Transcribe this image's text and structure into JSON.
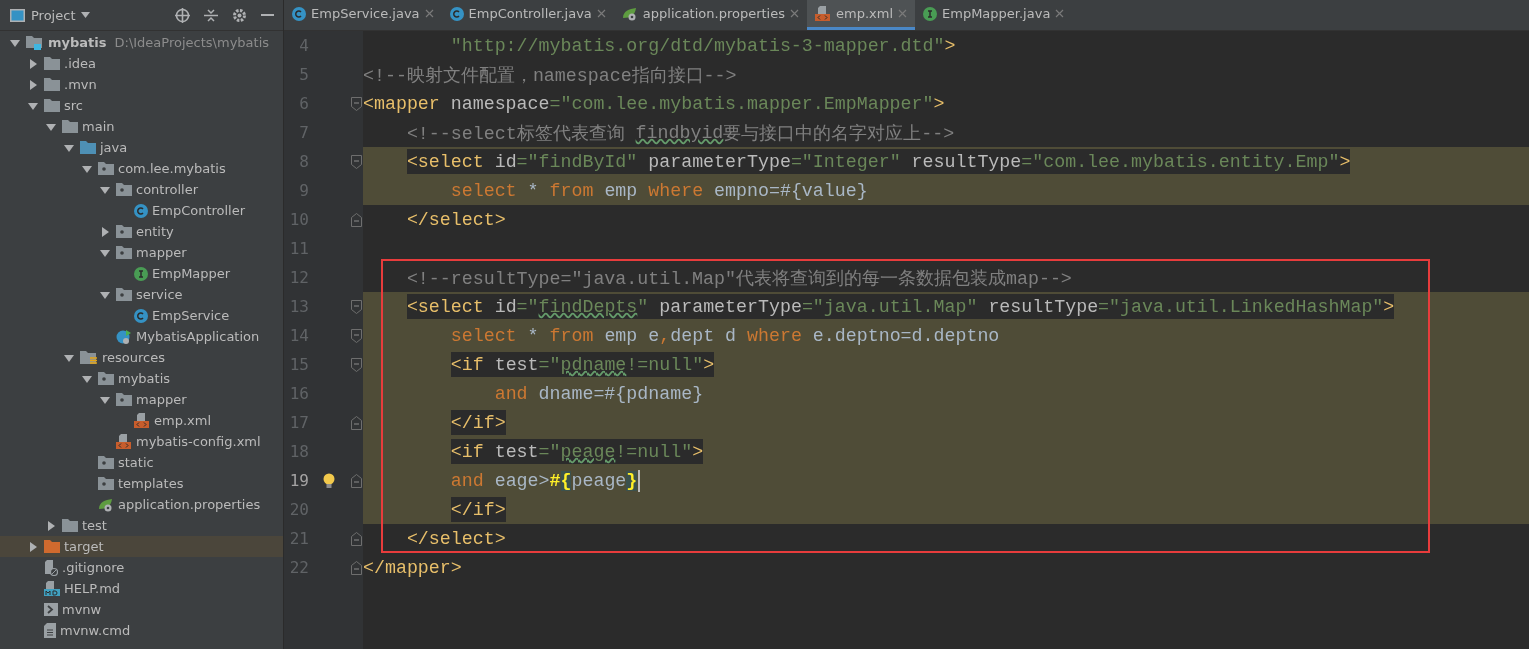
{
  "project_panel": {
    "title": "Project",
    "tree": [
      {
        "label": "mybatis",
        "path": "D:\\IdeaProjects\\mybatis",
        "kind": "module",
        "expanded": true,
        "selected": false,
        "children": [
          {
            "label": ".idea",
            "kind": "folder",
            "expanded": false,
            "selected": false
          },
          {
            "label": ".mvn",
            "kind": "folder",
            "expanded": false,
            "selected": false
          },
          {
            "label": "src",
            "kind": "folder",
            "expanded": true,
            "selected": false,
            "children": [
              {
                "label": "main",
                "kind": "folder",
                "expanded": true,
                "selected": false,
                "children": [
                  {
                    "label": "java",
                    "kind": "source",
                    "expanded": true,
                    "selected": false,
                    "children": [
                      {
                        "label": "com.lee.mybatis",
                        "kind": "package",
                        "expanded": true,
                        "selected": false,
                        "children": [
                          {
                            "label": "controller",
                            "kind": "package",
                            "expanded": true,
                            "selected": false,
                            "children": [
                              {
                                "label": "EmpController",
                                "kind": "class",
                                "selected": false
                              }
                            ]
                          },
                          {
                            "label": "entity",
                            "kind": "package",
                            "expanded": false,
                            "selected": false
                          },
                          {
                            "label": "mapper",
                            "kind": "package",
                            "expanded": true,
                            "selected": false,
                            "children": [
                              {
                                "label": "EmpMapper",
                                "kind": "interface",
                                "selected": false
                              }
                            ]
                          },
                          {
                            "label": "service",
                            "kind": "package",
                            "expanded": true,
                            "selected": false,
                            "children": [
                              {
                                "label": "EmpService",
                                "kind": "class",
                                "selected": false
                              }
                            ]
                          },
                          {
                            "label": "MybatisApplication",
                            "kind": "app",
                            "selected": false
                          }
                        ]
                      }
                    ]
                  },
                  {
                    "label": "resources",
                    "kind": "resources",
                    "expanded": true,
                    "selected": false,
                    "children": [
                      {
                        "label": "mybatis",
                        "kind": "package",
                        "expanded": true,
                        "selected": false,
                        "children": [
                          {
                            "label": "mapper",
                            "kind": "package",
                            "expanded": true,
                            "selected": false,
                            "children": [
                              {
                                "label": "emp.xml",
                                "kind": "xml",
                                "selected": false
                              }
                            ]
                          },
                          {
                            "label": "mybatis-config.xml",
                            "kind": "xml",
                            "selected": false
                          }
                        ]
                      },
                      {
                        "label": "static",
                        "kind": "package",
                        "selected": false
                      },
                      {
                        "label": "templates",
                        "kind": "package",
                        "selected": false
                      },
                      {
                        "label": "application.properties",
                        "kind": "properties",
                        "selected": false
                      }
                    ]
                  }
                ]
              },
              {
                "label": "test",
                "kind": "folder",
                "expanded": false,
                "selected": false
              }
            ]
          },
          {
            "label": "target",
            "kind": "excluded",
            "expanded": false,
            "selected": true
          },
          {
            "label": ".gitignore",
            "kind": "ignore",
            "selected": false
          },
          {
            "label": "HELP.md",
            "kind": "md",
            "selected": false
          },
          {
            "label": "mvnw",
            "kind": "script",
            "selected": false
          },
          {
            "label": "mvnw.cmd",
            "kind": "text",
            "selected": false
          }
        ]
      }
    ]
  },
  "tabs": [
    {
      "label": "EmpService.java",
      "kind": "class",
      "selected": false
    },
    {
      "label": "EmpController.java",
      "kind": "class",
      "selected": false
    },
    {
      "label": "application.properties",
      "kind": "properties",
      "selected": false
    },
    {
      "label": "emp.xml",
      "kind": "xml",
      "selected": true
    },
    {
      "label": "EmpMapper.java",
      "kind": "interface",
      "selected": false
    }
  ],
  "blocks": [
    {
      "boxed": false,
      "lines": [
        {
          "n": "4",
          "highlighted": false,
          "tag_backdrop": false,
          "fold_start": false,
          "fold_end": false,
          "current": false,
          "bulb": false,
          "tokens": [
            {
              "kind": "str",
              "text": "        \"http://mybatis.org/dtd/mybatis-3-mapper.dtd\""
            },
            {
              "kind": "tag",
              "text": ">"
            }
          ]
        },
        {
          "n": "5",
          "highlighted": false,
          "tag_backdrop": false,
          "fold_start": false,
          "fold_end": false,
          "current": false,
          "bulb": false,
          "tokens": [
            {
              "kind": "comment",
              "text": "<!--映射文件配置，namespace指向接口-->"
            }
          ]
        },
        {
          "n": "6",
          "highlighted": false,
          "tag_backdrop": false,
          "fold_start": true,
          "fold_end": false,
          "current": false,
          "bulb": false,
          "tokens": [
            {
              "kind": "tag",
              "text": "<mapper"
            },
            {
              "kind": "attr",
              "text": " namespace"
            },
            {
              "kind": "str",
              "text": "=\"com.lee.mybatis.mapper.EmpMapper\""
            },
            {
              "kind": "tag",
              "text": ">"
            }
          ]
        },
        {
          "n": "7",
          "highlighted": false,
          "tag_backdrop": false,
          "fold_start": false,
          "fold_end": false,
          "current": false,
          "bulb": false,
          "tokens": [
            {
              "kind": "comment",
              "text": "    <!--select标签代表查询 "
            },
            {
              "kind": "commenttypo",
              "text": "findbyid"
            },
            {
              "kind": "comment",
              "text": "要与接口中的名字对应上-->"
            }
          ]
        },
        {
          "n": "8",
          "highlighted": true,
          "tag_backdrop": true,
          "fold_start": true,
          "fold_end": false,
          "current": false,
          "bulb": false,
          "tokens": [
            {
              "kind": "tag",
              "text": "    <select"
            },
            {
              "kind": "attr",
              "text": " id"
            },
            {
              "kind": "str",
              "text": "=\"findById\""
            },
            {
              "kind": "attr",
              "text": " parameterType"
            },
            {
              "kind": "str",
              "text": "=\"Integer\""
            },
            {
              "kind": "attr",
              "text": " resultType"
            },
            {
              "kind": "str",
              "text": "=\"com.lee.mybatis.entity.Emp\""
            },
            {
              "kind": "tag",
              "text": ">"
            }
          ]
        },
        {
          "n": "9",
          "highlighted": true,
          "tag_backdrop": false,
          "fold_start": false,
          "fold_end": false,
          "current": false,
          "bulb": false,
          "tokens": [
            {
              "kind": "kw",
              "text": "        select"
            },
            {
              "kind": "plain",
              "text": " * "
            },
            {
              "kind": "kw",
              "text": "from"
            },
            {
              "kind": "plain",
              "text": " emp "
            },
            {
              "kind": "kw",
              "text": "where"
            },
            {
              "kind": "plain",
              "text": " empno=#{value}"
            }
          ]
        },
        {
          "n": "10",
          "highlighted": false,
          "tag_backdrop": true,
          "fold_start": false,
          "fold_end": true,
          "current": false,
          "bulb": false,
          "tokens": [
            {
              "kind": "tag",
              "text": "    </select>"
            }
          ]
        },
        {
          "n": "11",
          "highlighted": false,
          "fold_start": false,
          "fold_end": false,
          "current": false,
          "bulb": false
        }
      ]
    },
    {
      "boxed": true,
      "lines": [
        {
          "n": "12",
          "highlighted": false,
          "tag_backdrop": false,
          "fold_start": false,
          "fold_end": false,
          "current": false,
          "bulb": false,
          "tokens": [
            {
              "kind": "comment",
              "text": "    <!--resultType=\"java.util.Map\"代表将查询到的每一条数据包装成map-->"
            }
          ]
        },
        {
          "n": "13",
          "highlighted": true,
          "tag_backdrop": true,
          "fold_start": true,
          "fold_end": false,
          "current": false,
          "bulb": false,
          "tokens": [
            {
              "kind": "tag",
              "text": "    <select"
            },
            {
              "kind": "attr",
              "text": " id"
            },
            {
              "kind": "str",
              "text": "=\""
            },
            {
              "kind": "strtypo",
              "text": "findDepts"
            },
            {
              "kind": "str",
              "text": "\""
            },
            {
              "kind": "attr",
              "text": " parameterType"
            },
            {
              "kind": "str",
              "text": "=\"java.util.Map\""
            },
            {
              "kind": "attr",
              "text": " resultType"
            },
            {
              "kind": "str",
              "text": "=\"java.util.LinkedHashMap\""
            },
            {
              "kind": "tag",
              "text": ">"
            }
          ]
        },
        {
          "n": "14",
          "highlighted": true,
          "tag_backdrop": false,
          "fold_start": true,
          "fold_end": false,
          "current": false,
          "bulb": false,
          "tokens": [
            {
              "kind": "kw",
              "text": "        select"
            },
            {
              "kind": "plain",
              "text": " * "
            },
            {
              "kind": "kw",
              "text": "from"
            },
            {
              "kind": "plain",
              "text": " emp e"
            },
            {
              "kind": "kw",
              "text": ","
            },
            {
              "kind": "plain",
              "text": "dept d "
            },
            {
              "kind": "kw",
              "text": "where"
            },
            {
              "kind": "plain",
              "text": " e.deptno=d.deptno"
            }
          ]
        },
        {
          "n": "15",
          "highlighted": true,
          "tag_backdrop": true,
          "fold_start": true,
          "fold_end": false,
          "current": false,
          "bulb": false,
          "tokens": [
            {
              "kind": "tag",
              "text": "        <if"
            },
            {
              "kind": "attr",
              "text": " test"
            },
            {
              "kind": "str",
              "text": "=\""
            },
            {
              "kind": "strtypo",
              "text": "pdname"
            },
            {
              "kind": "str",
              "text": "!=null\""
            },
            {
              "kind": "tag",
              "text": ">"
            }
          ]
        },
        {
          "n": "16",
          "highlighted": true,
          "tag_backdrop": false,
          "fold_start": false,
          "fold_end": false,
          "current": false,
          "bulb": false,
          "tokens": [
            {
              "kind": "kw",
              "text": "            and"
            },
            {
              "kind": "plain",
              "text": " dname=#{pdname}"
            }
          ]
        },
        {
          "n": "17",
          "highlighted": true,
          "tag_backdrop": true,
          "fold_start": false,
          "fold_end": true,
          "current": false,
          "bulb": false,
          "tokens": [
            {
              "kind": "tag",
              "text": "        </if>"
            }
          ]
        },
        {
          "n": "18",
          "highlighted": true,
          "tag_backdrop": true,
          "fold_start": false,
          "fold_end": false,
          "current": false,
          "bulb": false,
          "tokens": [
            {
              "kind": "tag",
              "text": "        <if"
            },
            {
              "kind": "attr",
              "text": " test"
            },
            {
              "kind": "str",
              "text": "=\""
            },
            {
              "kind": "strtypo",
              "text": "peage"
            },
            {
              "kind": "str",
              "text": "!=null\""
            },
            {
              "kind": "tag",
              "text": ">"
            }
          ]
        },
        {
          "n": "19",
          "highlighted": true,
          "tag_backdrop": false,
          "fold_start": false,
          "fold_end": true,
          "current": true,
          "bulb": true,
          "tokens": [
            {
              "kind": "kw",
              "text": "        and"
            },
            {
              "kind": "plain",
              "text": " eage>"
            },
            {
              "kind": "bright",
              "text": "#"
            },
            {
              "kind": "brace",
              "text": "{"
            },
            {
              "kind": "plain",
              "text": "peage"
            },
            {
              "kind": "brace",
              "text": "}"
            }
          ]
        },
        {
          "n": "20",
          "highlighted": true,
          "tag_backdrop": true,
          "fold_start": false,
          "fold_end": false,
          "current": false,
          "bulb": false,
          "tokens": [
            {
              "kind": "tag",
              "text": "        </if>"
            }
          ]
        },
        {
          "n": "21",
          "highlighted": false,
          "tag_backdrop": true,
          "fold_start": false,
          "fold_end": true,
          "current": false,
          "bulb": false,
          "tokens": [
            {
              "kind": "tag",
              "text": "    </select>"
            }
          ]
        }
      ]
    },
    {
      "boxed": false,
      "lines": [
        {
          "n": "22",
          "highlighted": false,
          "fold_start": false,
          "fold_end": true,
          "current": false,
          "bulb": false,
          "tokens": [
            {
              "kind": "tag",
              "text": "</mapper>"
            }
          ]
        }
      ]
    }
  ]
}
